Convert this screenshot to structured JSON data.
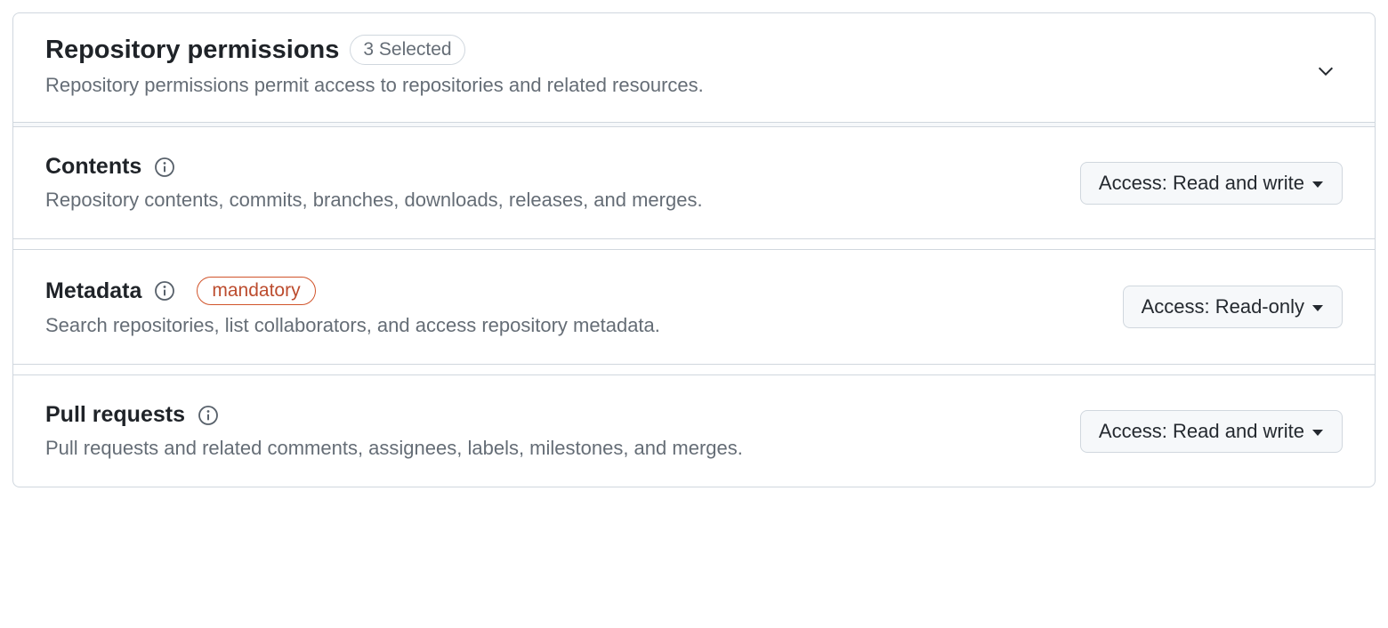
{
  "header": {
    "title": "Repository permissions",
    "selected_badge": "3 Selected",
    "description": "Repository permissions permit access to repositories and related resources."
  },
  "permissions": [
    {
      "title": "Contents",
      "description": "Repository contents, commits, branches, downloads, releases, and merges.",
      "access_label": "Access: Read and write",
      "mandatory": false
    },
    {
      "title": "Metadata",
      "description": "Search repositories, list collaborators, and access repository metadata.",
      "access_label": "Access: Read-only",
      "mandatory": true,
      "mandatory_label": "mandatory"
    },
    {
      "title": "Pull requests",
      "description": "Pull requests and related comments, assignees, labels, milestones, and merges.",
      "access_label": "Access: Read and write",
      "mandatory": false
    }
  ]
}
